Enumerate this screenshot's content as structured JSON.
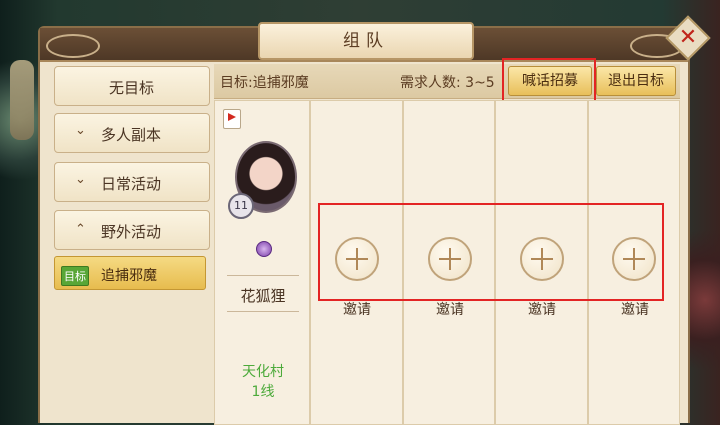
{
  "window": {
    "title": "组队"
  },
  "sidebar": {
    "items": [
      {
        "label": "无目标"
      },
      {
        "label": "多人副本"
      },
      {
        "label": "日常活动"
      },
      {
        "label": "野外活动"
      }
    ],
    "sub_item": {
      "tag": "目标",
      "label": "追捕邪魔"
    }
  },
  "header": {
    "target": "目标:追捕邪魔",
    "required_count": "需求人数: 3~5",
    "recruit_label": "喊话招募",
    "exit_label": "退出目标"
  },
  "leader": {
    "level": "11",
    "name": "花狐狸",
    "location_line1": "天化村",
    "location_line2": "1线"
  },
  "invite_slots": [
    {
      "label": "邀请"
    },
    {
      "label": "邀请"
    },
    {
      "label": "邀请"
    },
    {
      "label": "邀请"
    }
  ],
  "close": {
    "symbol": "✕"
  },
  "colors": {
    "accent_gold": "#e8bf5a",
    "highlight_red": "#e32424",
    "location_green": "#4caa3a"
  }
}
